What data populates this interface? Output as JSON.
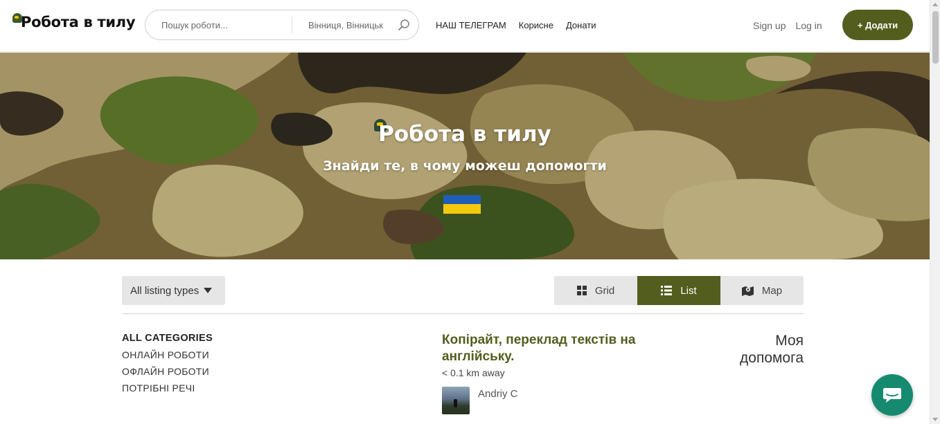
{
  "header": {
    "logo_text": "Робота в тилу",
    "search": {
      "query_placeholder": "Пошук роботи...",
      "location_value": "Вінниця, Вінницьк"
    },
    "nav": [
      {
        "label": "НАШ ТЕЛЕГРАМ"
      },
      {
        "label": "Корисне"
      },
      {
        "label": "Донати"
      }
    ],
    "signup_label": "Sign up",
    "login_label": "Log in",
    "add_label": "+ Додати"
  },
  "hero": {
    "title": "Робота в тилу",
    "subtitle": "Знайди те, в чому можеш допомогти"
  },
  "filters": {
    "listing_types_label": "All listing types",
    "views": [
      {
        "label": "Grid",
        "icon": "grid-icon",
        "active": false
      },
      {
        "label": "List",
        "icon": "list-icon",
        "active": true
      },
      {
        "label": "Map",
        "icon": "map-icon",
        "active": false
      }
    ]
  },
  "categories": {
    "heading": "ALL CATEGORIES",
    "items": [
      {
        "label": "ОНЛАЙН РОБОТИ"
      },
      {
        "label": "ОФЛАЙН РОБОТИ"
      },
      {
        "label": "ПОТРІБНІ РЕЧІ"
      }
    ]
  },
  "listing": {
    "title": "Копірайт, переклад текстів на англійську.",
    "distance": "< 0.1 km away",
    "author": "Andriy C"
  },
  "sidebar": {
    "my_help_label": "Моя допомога"
  },
  "colors": {
    "brand_olive": "#535d1d",
    "chat_green": "#168a6f",
    "flag_blue": "#1f5db8",
    "flag_yellow": "#f5c90e"
  }
}
